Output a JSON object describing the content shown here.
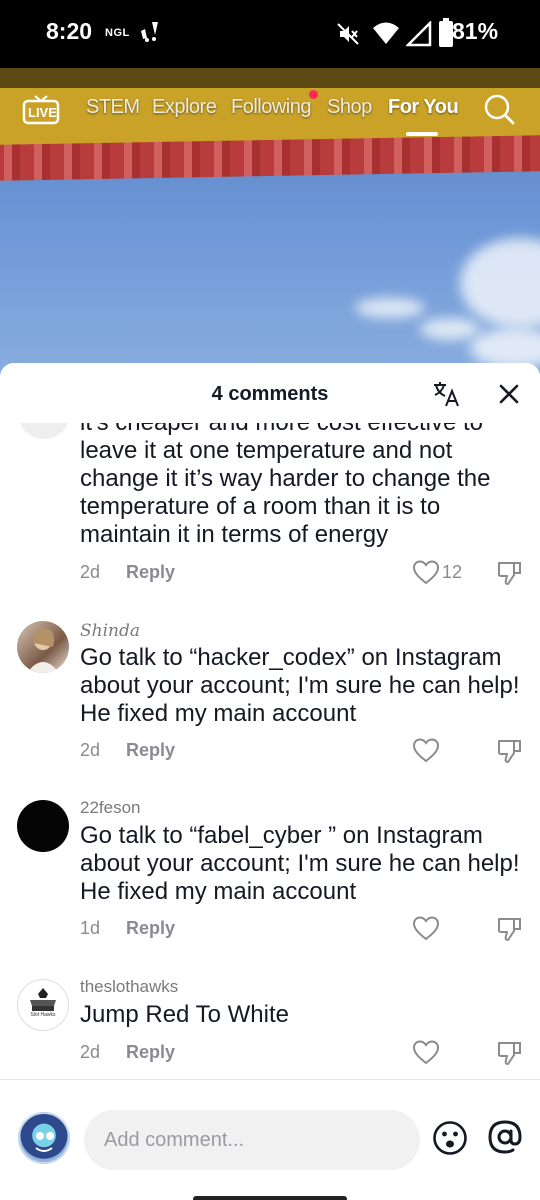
{
  "status_bar": {
    "time": "8:20",
    "carrier_tag": "NGL",
    "battery": "81%"
  },
  "top_nav": {
    "live_label": "LIVE",
    "tabs": [
      {
        "label": "STEM"
      },
      {
        "label": "Explore"
      },
      {
        "label": "Following"
      },
      {
        "label": "Shop"
      },
      {
        "label": "For You"
      }
    ],
    "active_tab": "For You"
  },
  "comments_sheet": {
    "title": "4 comments",
    "comments": [
      {
        "username": "",
        "text": "it's cheaper and more cost effective to leave it at one temperature and not change it it’s way harder to change the temperature of a room than it is to maintain it in terms of energy",
        "age": "2d",
        "reply_label": "Reply",
        "likes": "12"
      },
      {
        "username": "Shinda",
        "text": "Go talk to “hacker_codex” on Instagram about your account; I'm sure he can help! He fixed my main account",
        "age": "2d",
        "reply_label": "Reply",
        "likes": ""
      },
      {
        "username": "22feson",
        "text": "Go talk to “fabel_cyber ” on Instagram about your account; I'm sure he can help! He fixed my main account",
        "age": "1d",
        "reply_label": "Reply",
        "likes": ""
      },
      {
        "username": "theslothawks",
        "text": "Jump Red To White",
        "age": "2d",
        "reply_label": "Reply",
        "likes": "",
        "avatar_text": "Slot Hawks"
      }
    ],
    "composer": {
      "placeholder": "Add comment..."
    }
  },
  "colors": {
    "accent_dot": "#fe2c55",
    "text_primary": "#161823",
    "text_secondary": "#8a8b91"
  }
}
